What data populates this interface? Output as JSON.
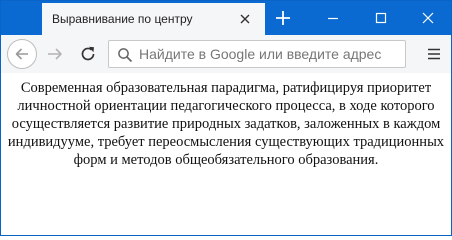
{
  "tab": {
    "title": "Выравнивание по центру"
  },
  "navbar": {
    "search_placeholder": "Найдите в Google или введите адрес"
  },
  "page": {
    "paragraph": "Современная образовательная парадигма, ратифицируя приоритет личностной ориентации педагогического процесса, в ходе которого осуществляется развитие природных задатков, заложенных в каждом индивидууме, требует переосмысления существующих традиционных форм и методов общеобязательного образования."
  },
  "colors": {
    "titlebar": "#0a6ad2",
    "toolbar": "#f5f6f7"
  },
  "icons": {
    "tab_close": "close-icon",
    "new_tab": "plus-icon",
    "minimize": "minimize-icon",
    "maximize": "maximize-icon",
    "close": "close-icon",
    "back": "arrow-left-icon",
    "forward": "arrow-right-icon",
    "reload": "reload-icon",
    "search": "search-icon",
    "menu": "hamburger-menu-icon"
  }
}
